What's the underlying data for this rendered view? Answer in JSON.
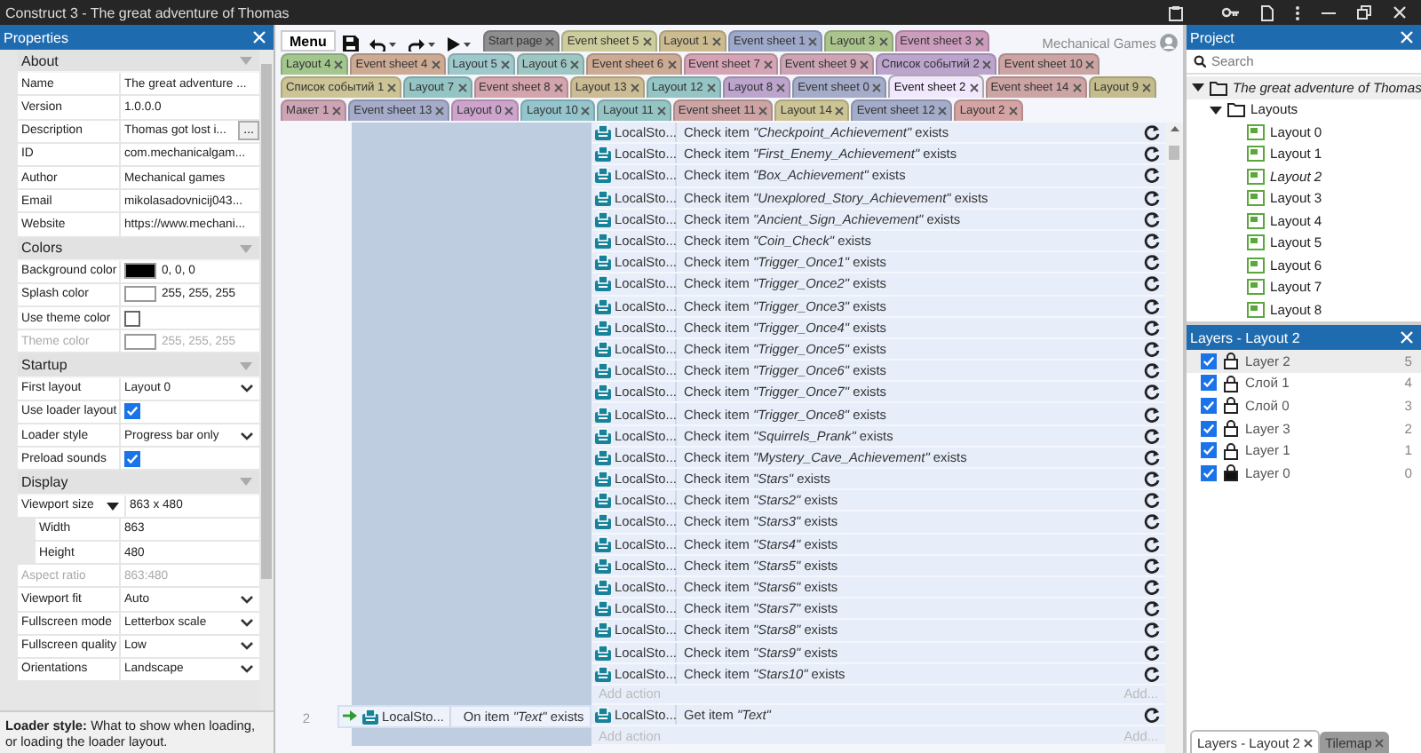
{
  "window": {
    "title": "Construct 3 - The great adventure of Thomas"
  },
  "properties": {
    "title": "Properties",
    "sections": [
      {
        "title": "About",
        "expanded": true,
        "rows": [
          {
            "kind": "text",
            "label": "Name",
            "value": "The great adventure ..."
          },
          {
            "kind": "text",
            "label": "Version",
            "value": "1.0.0.0"
          },
          {
            "kind": "button",
            "label": "Description",
            "value": "Thomas got lost i...",
            "button": "..."
          },
          {
            "kind": "text",
            "label": "ID",
            "value": "com.mechanicalgam..."
          },
          {
            "kind": "text",
            "label": "Author",
            "value": "Mechanical games"
          },
          {
            "kind": "text",
            "label": "Email",
            "value": "mikolasadovnicij043..."
          },
          {
            "kind": "text",
            "label": "Website",
            "value": "https://www.mechani..."
          }
        ]
      },
      {
        "title": "Colors",
        "expanded": true,
        "rows": [
          {
            "kind": "color",
            "label": "Background color",
            "color": "#000000",
            "value": "0, 0, 0",
            "disabled": false
          },
          {
            "kind": "color",
            "label": "Splash color",
            "color": "#ffffff",
            "value": "255, 255, 255",
            "disabled": false
          },
          {
            "kind": "check",
            "label": "Use theme color",
            "checked": false,
            "disabled": false
          },
          {
            "kind": "color",
            "label": "Theme color",
            "color": "#ffffff",
            "value": "255, 255, 255",
            "disabled": true
          }
        ]
      },
      {
        "title": "Startup",
        "expanded": true,
        "rows": [
          {
            "kind": "dropdown",
            "label": "First layout",
            "value": "Layout 0"
          },
          {
            "kind": "check",
            "label": "Use loader layout",
            "checked": true
          },
          {
            "kind": "dropdown",
            "label": "Loader style",
            "value": "Progress bar only"
          },
          {
            "kind": "check",
            "label": "Preload sounds",
            "checked": true
          }
        ]
      },
      {
        "title": "Display",
        "expanded": true,
        "rows": [
          {
            "kind": "group",
            "label": "Viewport size",
            "value": "863 x 480",
            "expanded": true,
            "disabled": false,
            "children": [
              {
                "label": "Width",
                "value": "863"
              },
              {
                "label": "Height",
                "value": "480"
              }
            ]
          },
          {
            "kind": "text",
            "label": "Aspect ratio",
            "value": "863:480",
            "disabled": true
          },
          {
            "kind": "dropdown",
            "label": "Viewport fit",
            "value": "Auto",
            "disabled": false
          },
          {
            "kind": "dropdown",
            "label": "Fullscreen mode",
            "value": "Letterbox scale",
            "disabled": false
          },
          {
            "kind": "dropdown",
            "label": "Fullscreen quality",
            "value": "Low",
            "disabled": false
          },
          {
            "kind": "dropdown",
            "label": "Orientations",
            "value": "Landscape",
            "disabled": false
          }
        ]
      }
    ],
    "help": "**Loader style:** What to show when loading, or loading the loader layout."
  },
  "toolbar": {
    "menu": "Menu",
    "user": "Mechanical Games"
  },
  "tab_rows": [
    [
      {
        "label": "Start page",
        "color": "#8e8e8e",
        "selected": false
      },
      {
        "label": "Event sheet 5",
        "color": "#cccc9c",
        "selected": false
      },
      {
        "label": "Layout 1",
        "color": "#cdbb90",
        "selected": false
      },
      {
        "label": "Event sheet 1",
        "color": "#9ea8c9",
        "selected": false
      },
      {
        "label": "Layout 3",
        "color": "#abc48e",
        "selected": false
      },
      {
        "label": "Event sheet 3",
        "color": "#cc9cbc",
        "selected": false
      }
    ],
    [
      {
        "label": "Layout 4",
        "color": "#a2c68e",
        "selected": false
      },
      {
        "label": "Event sheet 4",
        "color": "#cdaa94",
        "selected": false
      },
      {
        "label": "Layout 5",
        "color": "#9ec8cc",
        "selected": false
      },
      {
        "label": "Layout 6",
        "color": "#9ec6c2",
        "selected": false
      },
      {
        "label": "Event sheet 6",
        "color": "#cdaa94",
        "selected": false
      },
      {
        "label": "Event sheet 7",
        "color": "#d4a4b4",
        "selected": false
      },
      {
        "label": "Event sheet 9",
        "color": "#cca4b4",
        "selected": false
      },
      {
        "label": "Список событий 2",
        "color": "#bca4cc",
        "selected": false
      },
      {
        "label": "Event sheet 10",
        "color": "#cca4a4",
        "selected": false
      }
    ],
    [
      {
        "label": "Список событий 1",
        "color": "#ccc494",
        "selected": false
      },
      {
        "label": "Layout 7",
        "color": "#94c4c4",
        "selected": false
      },
      {
        "label": "Event sheet 8",
        "color": "#d4a4ac",
        "selected": false
      },
      {
        "label": "Layout 13",
        "color": "#ccbc94",
        "selected": false
      },
      {
        "label": "Layout 12",
        "color": "#94c4c4",
        "selected": false
      },
      {
        "label": "Layout 8",
        "color": "#bca4cc",
        "selected": false
      },
      {
        "label": "Event sheet 0",
        "color": "#a4acc9",
        "selected": false
      },
      {
        "label": "Event sheet 2",
        "color": "#f1e8fd",
        "selected": true
      },
      {
        "label": "Event sheet 14",
        "color": "#cca4a4",
        "selected": false
      },
      {
        "label": "Layout 9",
        "color": "#c4bc8c",
        "selected": false
      }
    ],
    [
      {
        "label": "Макет 1",
        "color": "#cca4b4",
        "selected": false
      },
      {
        "label": "Event sheet 13",
        "color": "#a4acc9",
        "selected": false
      },
      {
        "label": "Layout 0",
        "color": "#cca4cc",
        "selected": false
      },
      {
        "label": "Layout 10",
        "color": "#94c4cc",
        "selected": false
      },
      {
        "label": "Layout 11",
        "color": "#94c4c4",
        "selected": false
      },
      {
        "label": "Event sheet 11",
        "color": "#cca4a4",
        "selected": false
      },
      {
        "label": "Layout 14",
        "color": "#ccc494",
        "selected": false
      },
      {
        "label": "Event sheet 12",
        "color": "#a4acc9",
        "selected": false
      },
      {
        "label": "Layout 2",
        "color": "#d4a4a4",
        "selected": false
      }
    ]
  ],
  "event_sheet": {
    "events": [
      {
        "actions": [
          {
            "object": "LocalSto...",
            "text": "Check item *\"Checkpoint_Achievement\"* exists"
          },
          {
            "object": "LocalSto...",
            "text": "Check item *\"First_Enemy_Achievement\"* exists"
          },
          {
            "object": "LocalSto...",
            "text": "Check item *\"Box_Achievement\"* exists"
          },
          {
            "object": "LocalSto...",
            "text": "Check item *\"Unexplored_Story_Achievement\"* exists"
          },
          {
            "object": "LocalSto...",
            "text": "Check item *\"Ancient_Sign_Achievement\"* exists"
          },
          {
            "object": "LocalSto...",
            "text": "Check item *\"Coin_Check\"* exists"
          },
          {
            "object": "LocalSto...",
            "text": "Check item *\"Trigger_Once1\"* exists"
          },
          {
            "object": "LocalSto...",
            "text": "Check item *\"Trigger_Once2\"* exists"
          },
          {
            "object": "LocalSto...",
            "text": "Check item *\"Trigger_Once3\"* exists"
          },
          {
            "object": "LocalSto...",
            "text": "Check item *\"Trigger_Once4\"* exists"
          },
          {
            "object": "LocalSto...",
            "text": "Check item *\"Trigger_Once5\"* exists"
          },
          {
            "object": "LocalSto...",
            "text": "Check item *\"Trigger_Once6\"* exists"
          },
          {
            "object": "LocalSto...",
            "text": "Check item *\"Trigger_Once7\"* exists"
          },
          {
            "object": "LocalSto...",
            "text": "Check item *\"Trigger_Once8\"* exists"
          },
          {
            "object": "LocalSto...",
            "text": "Check item *\"Squirrels_Prank\"* exists"
          },
          {
            "object": "LocalSto...",
            "text": "Check item *\"Mystery_Cave_Achievement\"* exists"
          },
          {
            "object": "LocalSto...",
            "text": "Check item *\"Stars\"* exists"
          },
          {
            "object": "LocalSto...",
            "text": "Check item *\"Stars2\"* exists"
          },
          {
            "object": "LocalSto...",
            "text": "Check item *\"Stars3\"* exists"
          },
          {
            "object": "LocalSto...",
            "text": "Check item *\"Stars4\"* exists"
          },
          {
            "object": "LocalSto...",
            "text": "Check item *\"Stars5\"* exists"
          },
          {
            "object": "LocalSto...",
            "text": "Check item *\"Stars6\"* exists"
          },
          {
            "object": "LocalSto...",
            "text": "Check item *\"Stars7\"* exists"
          },
          {
            "object": "LocalSto...",
            "text": "Check item *\"Stars8\"* exists"
          },
          {
            "object": "LocalSto...",
            "text": "Check item *\"Stars9\"* exists"
          },
          {
            "object": "LocalSto...",
            "text": "Check item *\"Stars10\"* exists"
          }
        ],
        "add_action": "Add action",
        "add_link": "Add..."
      },
      {
        "number": "2",
        "condition": {
          "object": "LocalSto...",
          "text": "On item *\"Text\"* exists"
        },
        "actions": [
          {
            "object": "LocalSto...",
            "text": "Get item *\"Text\"*"
          }
        ],
        "add_action": "Add action",
        "add_link": "Add..."
      }
    ]
  },
  "project": {
    "title": "Project",
    "search": {
      "placeholder": "Search"
    },
    "tree": [
      {
        "kind": "project",
        "label": "The great adventure of Thomas",
        "expanded": true,
        "selected": true,
        "children": [
          {
            "kind": "folder",
            "label": "Layouts",
            "expanded": true,
            "selected": false,
            "children": [
              {
                "kind": "layout",
                "label": "Layout 0",
                "open": false,
                "selected": false
              },
              {
                "kind": "layout",
                "label": "Layout 1",
                "open": false,
                "selected": false
              },
              {
                "kind": "layout",
                "label": "Layout 2",
                "open": true,
                "selected": false
              },
              {
                "kind": "layout",
                "label": "Layout 3",
                "open": false,
                "selected": false
              },
              {
                "kind": "layout",
                "label": "Layout 4",
                "open": false,
                "selected": false
              },
              {
                "kind": "layout",
                "label": "Layout 5",
                "open": false,
                "selected": false
              },
              {
                "kind": "layout",
                "label": "Layout 6",
                "open": false,
                "selected": false
              },
              {
                "kind": "layout",
                "label": "Layout 7",
                "open": false,
                "selected": false
              },
              {
                "kind": "layout",
                "label": "Layout 8",
                "open": false,
                "selected": false
              }
            ]
          }
        ]
      }
    ]
  },
  "layers": {
    "title": "Layers - Layout 2",
    "items": [
      {
        "name": "Layer 2",
        "number": "5",
        "visible": true,
        "locked": false,
        "selected": true
      },
      {
        "name": "Слой 1",
        "number": "4",
        "visible": true,
        "locked": false,
        "selected": false
      },
      {
        "name": "Слой 0",
        "number": "3",
        "visible": true,
        "locked": false,
        "selected": false
      },
      {
        "name": "Layer 3",
        "number": "2",
        "visible": true,
        "locked": false,
        "selected": false
      },
      {
        "name": "Layer 1",
        "number": "1",
        "visible": true,
        "locked": false,
        "selected": false
      },
      {
        "name": "Layer 0",
        "number": "0",
        "visible": true,
        "locked": true,
        "selected": false
      }
    ]
  },
  "bottom_tabs": [
    {
      "label": "Layers - Layout 2",
      "selected": true
    },
    {
      "label": "Tilemap",
      "selected": false
    }
  ]
}
